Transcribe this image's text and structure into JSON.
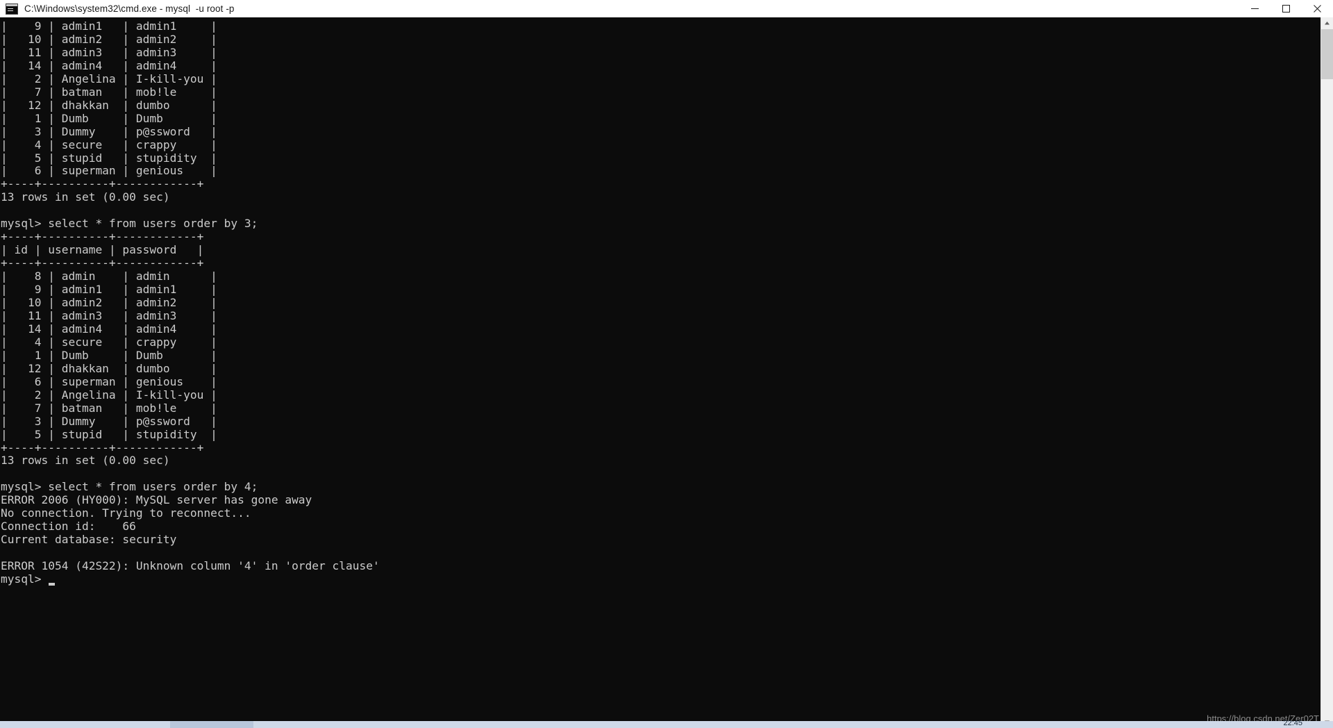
{
  "window": {
    "title": "C:\\Windows\\system32\\cmd.exe - mysql  -u root -p",
    "icon": "cmd-icon",
    "controls": {
      "minimize_label": "Minimize",
      "maximize_label": "Maximize",
      "close_label": "Close"
    }
  },
  "terminal": {
    "background_color": "#0c0c0c",
    "foreground_color": "#cccccc",
    "prompt": "mysql>",
    "cursor_visible": true,
    "content": "|    9 | admin1   | admin1     |\n|   10 | admin2   | admin2     |\n|   11 | admin3   | admin3     |\n|   14 | admin4   | admin4     |\n|    2 | Angelina | I-kill-you |\n|    7 | batman   | mob!le     |\n|   12 | dhakkan  | dumbo      |\n|    1 | Dumb     | Dumb       |\n|    3 | Dummy    | p@ssword   |\n|    4 | secure   | crappy     |\n|    5 | stupid   | stupidity  |\n|    6 | superman | genious    |\n+----+----------+------------+\n13 rows in set (0.00 sec)\n\nmysql> select * from users order by 3;\n+----+----------+------------+\n| id | username | password   |\n+----+----------+------------+\n|    8 | admin    | admin      |\n|    9 | admin1   | admin1     |\n|   10 | admin2   | admin2     |\n|   11 | admin3   | admin3     |\n|   14 | admin4   | admin4     |\n|    4 | secure   | crappy     |\n|    1 | Dumb     | Dumb       |\n|   12 | dhakkan  | dumbo      |\n|    6 | superman | genious    |\n|    2 | Angelina | I-kill-you |\n|    7 | batman   | mob!le     |\n|    3 | Dummy    | p@ssword   |\n|    5 | stupid   | stupidity  |\n+----+----------+------------+\n13 rows in set (0.00 sec)\n\nmysql> select * from users order by 4;\nERROR 2006 (HY000): MySQL server has gone away\nNo connection. Trying to reconnect...\nConnection id:    66\nCurrent database: security\n\nERROR 1054 (42S22): Unknown column '4' in 'order clause'\nmysql> "
  },
  "session": {
    "queries": [
      "select * from users order by 3;",
      "select * from users order by 4;"
    ],
    "table_columns": [
      "id",
      "username",
      "password"
    ],
    "first_result": {
      "rows": [
        [
          "9",
          "admin1",
          "admin1"
        ],
        [
          "10",
          "admin2",
          "admin2"
        ],
        [
          "11",
          "admin3",
          "admin3"
        ],
        [
          "14",
          "admin4",
          "admin4"
        ],
        [
          "2",
          "Angelina",
          "I-kill-you"
        ],
        [
          "7",
          "batman",
          "mob!le"
        ],
        [
          "12",
          "dhakkan",
          "dumbo"
        ],
        [
          "1",
          "Dumb",
          "Dumb"
        ],
        [
          "3",
          "Dummy",
          "p@ssword"
        ],
        [
          "4",
          "secure",
          "crappy"
        ],
        [
          "5",
          "stupid",
          "stupidity"
        ],
        [
          "6",
          "superman",
          "genious"
        ]
      ],
      "status": "13 rows in set (0.00 sec)"
    },
    "second_result": {
      "rows": [
        [
          "8",
          "admin",
          "admin"
        ],
        [
          "9",
          "admin1",
          "admin1"
        ],
        [
          "10",
          "admin2",
          "admin2"
        ],
        [
          "11",
          "admin3",
          "admin3"
        ],
        [
          "14",
          "admin4",
          "admin4"
        ],
        [
          "4",
          "secure",
          "crappy"
        ],
        [
          "1",
          "Dumb",
          "Dumb"
        ],
        [
          "12",
          "dhakkan",
          "dumbo"
        ],
        [
          "6",
          "superman",
          "genious"
        ],
        [
          "2",
          "Angelina",
          "I-kill-you"
        ],
        [
          "7",
          "batman",
          "mob!le"
        ],
        [
          "3",
          "Dummy",
          "p@ssword"
        ],
        [
          "5",
          "stupid",
          "stupidity"
        ]
      ],
      "status": "13 rows in set (0.00 sec)"
    },
    "errors": [
      "ERROR 2006 (HY000): MySQL server has gone away",
      "No connection. Trying to reconnect...",
      "Connection id:    66",
      "Current database: security",
      "ERROR 1054 (42S22): Unknown column '4' in 'order clause'"
    ]
  },
  "scrollbar": {
    "up_arrow": "chevron-up-icon",
    "down_arrow": "chevron-down-icon"
  },
  "watermark": {
    "text": "https://blog.csdn.net/Zer02T"
  },
  "taskbar": {
    "clock": "22:45"
  }
}
